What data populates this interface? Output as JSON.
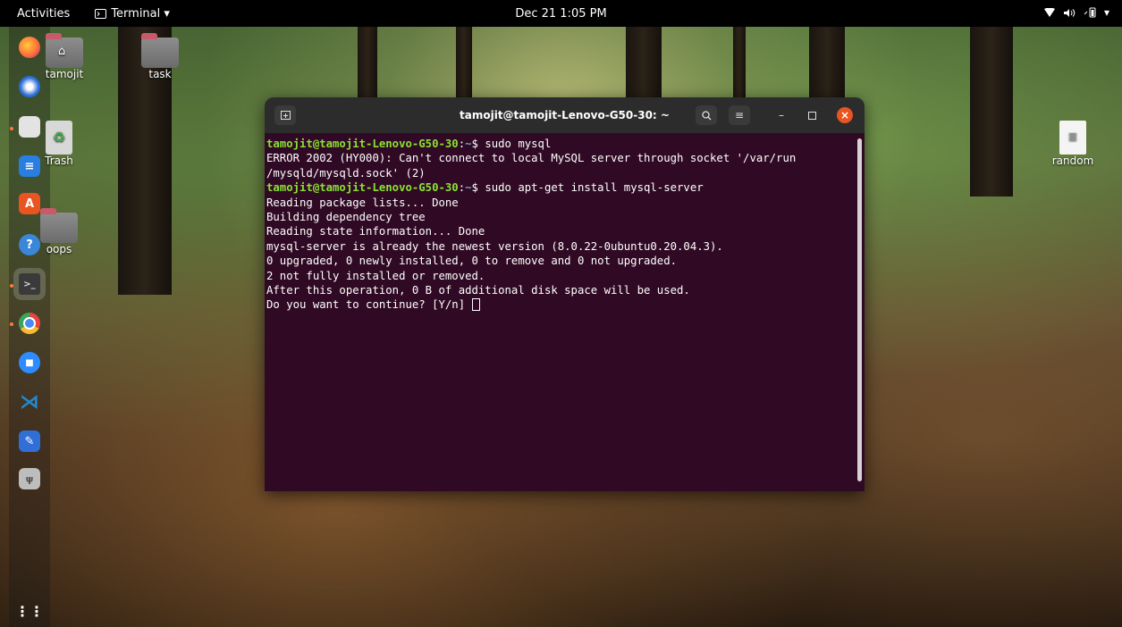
{
  "topbar": {
    "activities": "Activities",
    "app_icon": "terminal-icon",
    "app_label": "Terminal ▾",
    "clock": "Dec 21  1:05 PM",
    "tray": {
      "network_icon": "wifi-icon",
      "volume_icon": "speaker-icon",
      "battery_icon": "battery-icon",
      "menu_arrow": "▾"
    }
  },
  "dock": {
    "items": [
      {
        "name": "Firefox",
        "icon": "firefox-icon",
        "color": "#ff7139"
      },
      {
        "name": "Thunderbird",
        "icon": "mail-icon",
        "color": "#2b6cd8"
      },
      {
        "name": "Files",
        "icon": "folder-icon",
        "color": "#e3e3e3"
      },
      {
        "name": "LibreOffice Writer",
        "icon": "document-icon",
        "color": "#2a7de1"
      },
      {
        "name": "Ubuntu Software",
        "icon": "store-icon",
        "color": "#e95420"
      },
      {
        "name": "Help",
        "icon": "help-icon",
        "color": "#3a86d8"
      },
      {
        "name": "Terminal",
        "icon": "terminal-icon",
        "color": "#3a3a3a"
      },
      {
        "name": "Google Chrome",
        "icon": "chrome-icon",
        "color": "#e8453c"
      },
      {
        "name": "Zoom",
        "icon": "video-icon",
        "color": "#2d8cff"
      },
      {
        "name": "Visual Studio Code",
        "icon": "code-icon",
        "color": "#1f8ad2"
      },
      {
        "name": "Text Editor",
        "icon": "pencil-icon",
        "color": "#2f6fd6"
      },
      {
        "name": "USB Drive",
        "icon": "usb-icon",
        "color": "#bdbdbd"
      }
    ],
    "show_apps_icon": "grid-icon"
  },
  "desktop": {
    "icons": [
      {
        "label": "tamojit",
        "icon": "home-folder-icon"
      },
      {
        "label": "task",
        "icon": "folder-icon"
      },
      {
        "label": "Trash",
        "icon": "trash-icon"
      },
      {
        "label": "oops",
        "icon": "folder-icon"
      },
      {
        "label": "random",
        "icon": "text-file-icon"
      }
    ]
  },
  "terminal": {
    "title": "tamojit@tamojit-Lenovo-G50-30: ~",
    "new_tab_icon": "new-tab-icon",
    "search_icon": "search-icon",
    "menu_icon": "hamburger-icon",
    "lines": [
      {
        "user": "tamojit@tamojit-Lenovo-G50-30",
        "path": "~",
        "cmd": "$ sudo mysql"
      },
      {
        "text": "ERROR 2002 (HY000): Can't connect to local MySQL server through socket '/var/run"
      },
      {
        "text": "/mysqld/mysqld.sock' (2)"
      },
      {
        "user": "tamojit@tamojit-Lenovo-G50-30",
        "path": "~",
        "cmd": "$ sudo apt-get install mysql-server"
      },
      {
        "text": "Reading package lists... Done"
      },
      {
        "text": "Building dependency tree"
      },
      {
        "text": "Reading state information... Done"
      },
      {
        "text": "mysql-server is already the newest version (8.0.22-0ubuntu0.20.04.3)."
      },
      {
        "text": "0 upgraded, 0 newly installed, 0 to remove and 0 not upgraded."
      },
      {
        "text": "2 not fully installed or removed."
      },
      {
        "text": "After this operation, 0 B of additional disk space will be used."
      },
      {
        "text": "Do you want to continue? [Y/n] "
      }
    ]
  }
}
